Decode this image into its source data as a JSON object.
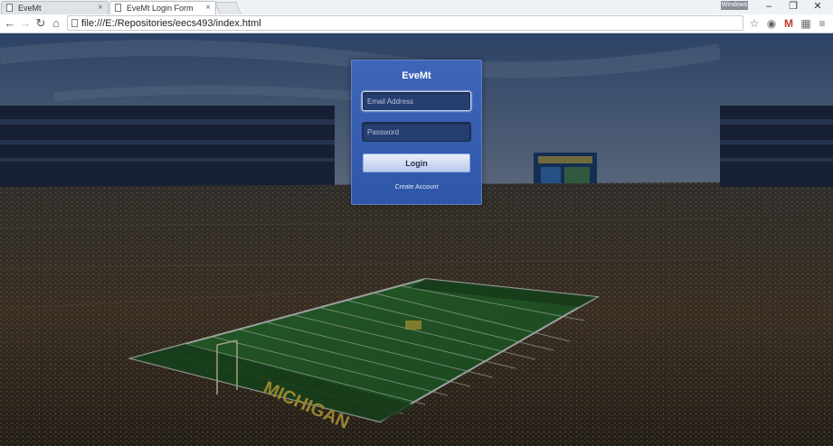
{
  "browser": {
    "tabs": [
      {
        "label": "EveMt",
        "active": false
      },
      {
        "label": "EveMt Login Form",
        "active": true
      }
    ],
    "user_badge": "Windows",
    "window_controls": {
      "minimize": "–",
      "restore": "❐",
      "close": "✕"
    },
    "address_bar": {
      "url": "file:///E:/Repositories/eecs493/index.html"
    },
    "nav_icons": [
      "back-icon",
      "forward-icon",
      "reload-icon",
      "home-icon"
    ],
    "toolbar_icons": [
      "star-icon",
      "extension-icon",
      "gmail-icon",
      "apps-icon",
      "menu-icon"
    ]
  },
  "login": {
    "title": "EveMt",
    "email_placeholder": "Email Address",
    "password_placeholder": "Password",
    "login_button": "Login",
    "create_account": "Create Account"
  },
  "background": {
    "description_colors": {
      "sky": "#4b6a94",
      "field": "#2f6b2a",
      "crowd": "#3a2e22",
      "brand_blue": "#3e66b8"
    },
    "end_zone_text": "MICHIGAN"
  }
}
